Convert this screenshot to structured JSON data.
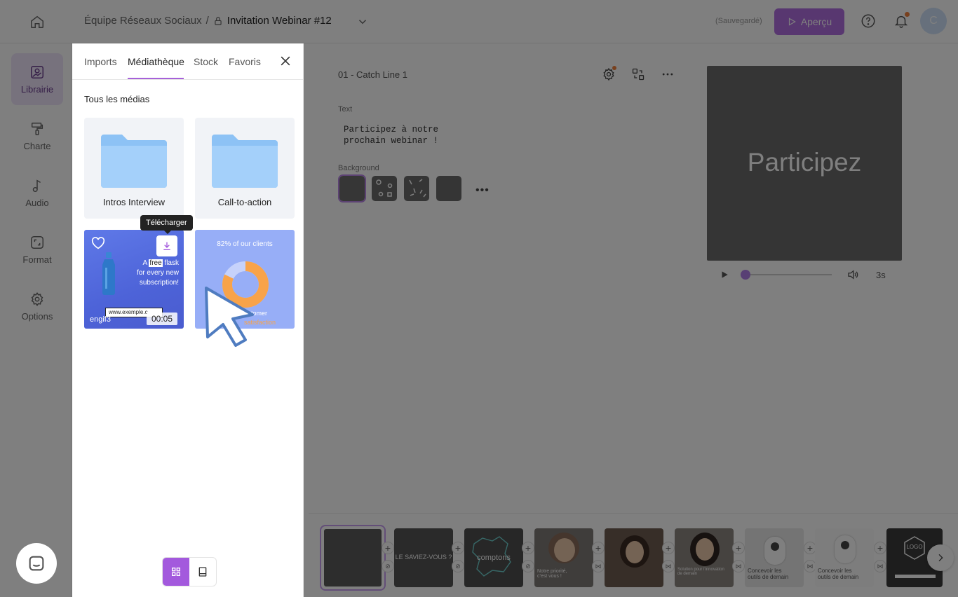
{
  "header": {
    "team": "Équipe Réseaux Sociaux",
    "separator": "/",
    "doc_title": "Invitation Webinar #12",
    "saved_status": "(Sauvegardé)",
    "preview_button": "Aperçu",
    "avatar_initial": "C",
    "accent_color": "#b06ee0"
  },
  "rail": {
    "items": [
      {
        "label": "Librairie",
        "icon": "image-icon",
        "active": true
      },
      {
        "label": "Charte",
        "icon": "paint-roller-icon"
      },
      {
        "label": "Audio",
        "icon": "music-note-icon"
      },
      {
        "label": "Format",
        "icon": "crop-icon"
      },
      {
        "label": "Options",
        "icon": "gear-icon"
      }
    ]
  },
  "library": {
    "tabs": [
      "Imports",
      "Médiathèque",
      "Stock",
      "Favoris"
    ],
    "active_tab": "Médiathèque",
    "section_title": "Tous les médias",
    "folders": [
      {
        "name": "Intros Interview"
      },
      {
        "name": "Call-to-action"
      }
    ],
    "media": [
      {
        "name": "engif3",
        "duration": "00:05",
        "overlay_lines": [
          "A ",
          "free",
          " flask",
          "for every new",
          "subscription!"
        ],
        "url_text": "www.exemple.c"
      },
      {
        "headline": "82% of our clients",
        "customer_text": "customer",
        "customer_sub": "satisfaction"
      }
    ],
    "tooltip": "Télécharger"
  },
  "editor": {
    "scene_name": "01 - Catch Line 1",
    "text_label": "Text",
    "text_value": "Participez à notre\nprochain webinar !",
    "background_label": "Background",
    "more": "•••"
  },
  "preview": {
    "text": "Participez",
    "duration": "3s",
    "progress": 0
  },
  "timeline": {
    "scenes": [
      {
        "text": ""
      },
      {
        "text": "LE SAVIEZ-VOUS ?"
      },
      {
        "text": "comptons"
      },
      {
        "text": "Notre priorité,\nc'est vous !"
      },
      {
        "text": ""
      },
      {
        "text": "Solution pour l'innovation\nde demain"
      },
      {
        "text": "Concevoir les\noutils de demain"
      },
      {
        "text": "Concevoir les\noutils de demain"
      },
      {
        "text": "LOGO"
      }
    ]
  }
}
